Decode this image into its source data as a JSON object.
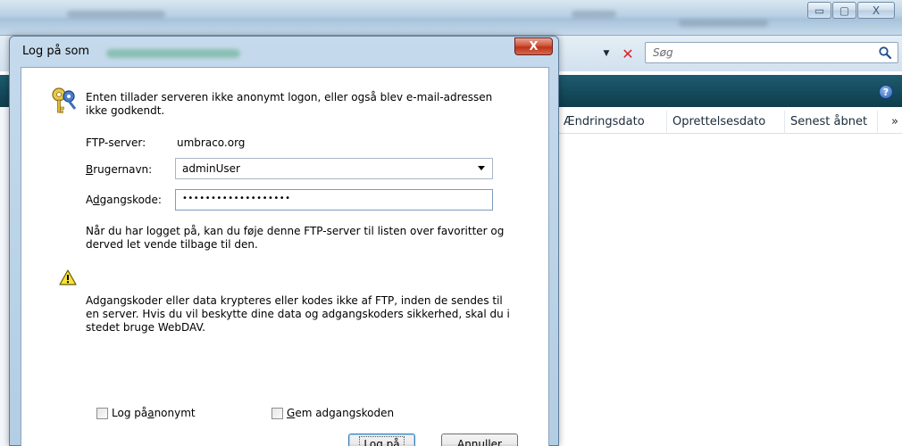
{
  "explorer": {
    "search_placeholder": "Søg",
    "columns": [
      "Ændringsdato",
      "Oprettelsesdato",
      "Senest åbnet"
    ],
    "more_columns_glyph": "»",
    "help_glyph": "?",
    "window_controls": {
      "minimize": "▭",
      "maximize": "▢",
      "close": "X"
    }
  },
  "dialog": {
    "title": "Log på som",
    "close_glyph": "X",
    "intro_text": "Enten tillader serveren ikke anonymt logon, eller også blev e-mail-adressen ikke godkendt.",
    "ftp_label": "FTP-server:",
    "ftp_value": "umbraco.org",
    "username": {
      "label_pre": "",
      "label_u": "B",
      "label_post": "rugernavn:",
      "value": "adminUser"
    },
    "password": {
      "label_pre": "A",
      "label_u": "d",
      "label_post": "gangskode:",
      "value": "•••••••••••••••••••"
    },
    "info_text": "Når du har logget på, kan du føje denne FTP-server til listen over favoritter og derved let vende tilbage til den.",
    "warning_text": "Adgangskoder eller data krypteres eller kodes ikke af FTP, inden de sendes til en server. Hvis du vil beskytte dine data og adgangskoders sikkerhed, skal du i stedet bruge WebDAV.",
    "anon_checkbox": {
      "pre": "Log på ",
      "u": "a",
      "post": "nonymt"
    },
    "save_checkbox": {
      "pre": "",
      "u": "G",
      "post": "em adgangskoden"
    },
    "login_button": {
      "pre": "",
      "u": "L",
      "post": "og på"
    },
    "cancel_button": "Annuller"
  },
  "colors": {
    "toolbar_teal": "#154c5e",
    "close_red": "#c9432a",
    "dialog_frame": "#b9d1e6"
  }
}
